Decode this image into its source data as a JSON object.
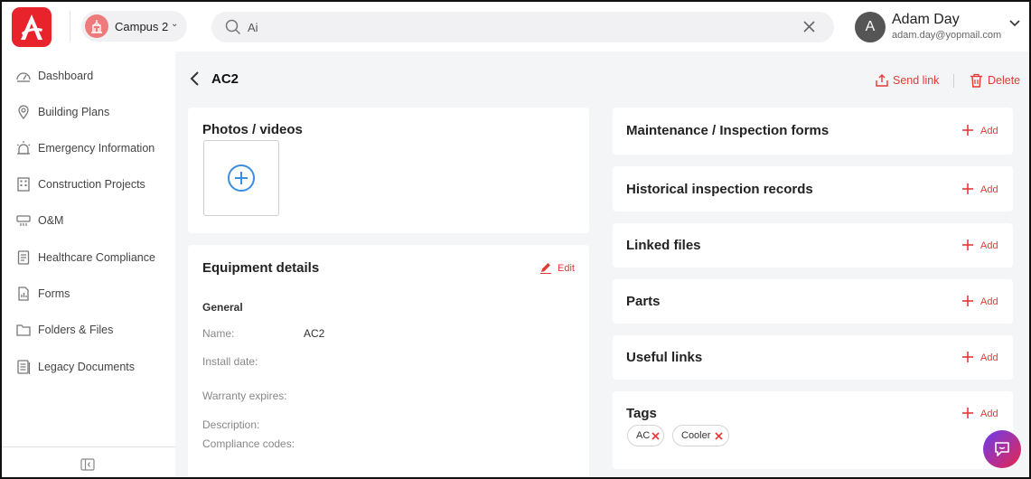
{
  "topbar": {
    "campus_label": "Campus 2",
    "search_value": "Ai",
    "user": {
      "initial": "A",
      "name": "Adam Day",
      "email": "adam.day@yopmail.com"
    }
  },
  "sidebar": {
    "items": [
      {
        "label": "Dashboard",
        "icon": "dashboard-icon"
      },
      {
        "label": "Building Plans",
        "icon": "map-pin-icon"
      },
      {
        "label": "Emergency Information",
        "icon": "siren-icon"
      },
      {
        "label": "Construction Projects",
        "icon": "building-icon"
      },
      {
        "label": "O&M",
        "icon": "air-conditioner-icon"
      },
      {
        "label": "Healthcare Compliance",
        "icon": "clipboard-icon"
      },
      {
        "label": "Forms",
        "icon": "form-icon"
      },
      {
        "label": "Folders & Files",
        "icon": "folder-icon"
      },
      {
        "label": "Legacy Documents",
        "icon": "documents-icon"
      }
    ]
  },
  "page": {
    "title": "AC2",
    "send_link": "Send link",
    "delete": "Delete"
  },
  "photos": {
    "title": "Photos / videos"
  },
  "equipment": {
    "title": "Equipment details",
    "edit_label": "Edit",
    "section": "General",
    "fields": [
      {
        "label": "Name:",
        "value": "AC2"
      },
      {
        "label": "Install date:",
        "value": ""
      },
      {
        "label": "Warranty expires:",
        "value": ""
      },
      {
        "label": "Description:",
        "value": ""
      },
      {
        "label": "Compliance codes:",
        "value": ""
      }
    ]
  },
  "right_cards": [
    {
      "title": "Maintenance / Inspection forms",
      "add_label": "Add"
    },
    {
      "title": "Historical inspection records",
      "add_label": "Add"
    },
    {
      "title": "Linked files",
      "add_label": "Add"
    },
    {
      "title": "Parts",
      "add_label": "Add"
    },
    {
      "title": "Useful links",
      "add_label": "Add"
    },
    {
      "title": "Tags",
      "add_label": "Add"
    }
  ],
  "tags": [
    "AC",
    "Cooler"
  ],
  "colors": {
    "brand": "#e8232b",
    "accent": "#e53935",
    "plus_blue": "#3b8fe0"
  }
}
